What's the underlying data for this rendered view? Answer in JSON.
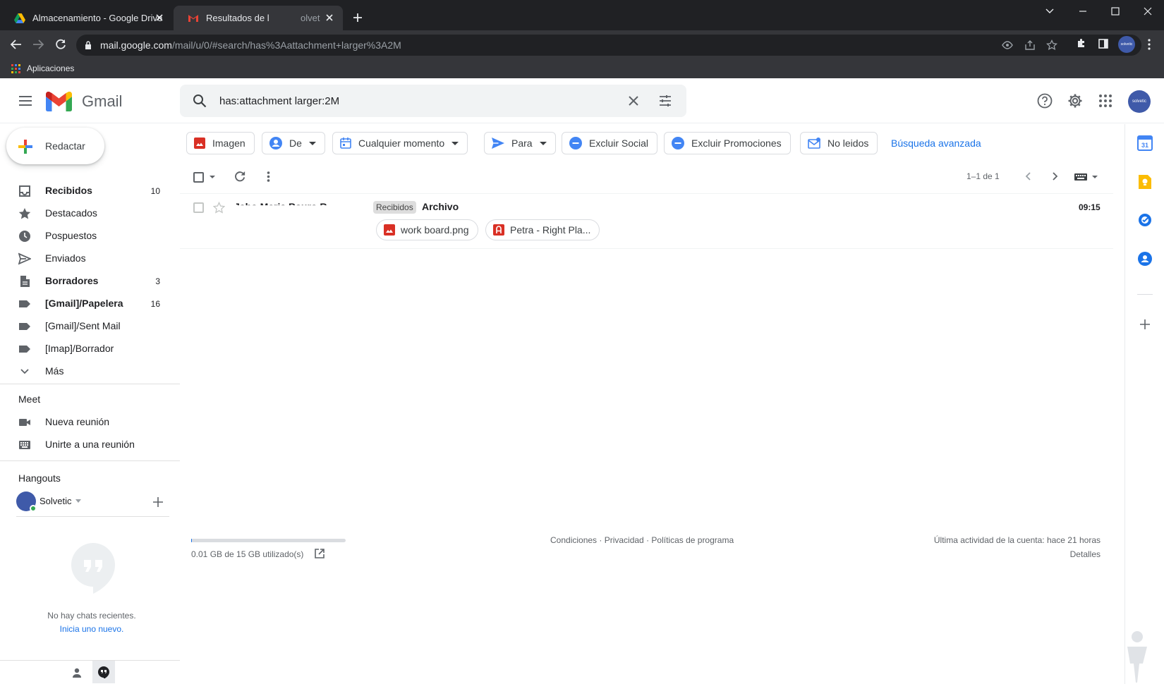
{
  "browser": {
    "tabs": [
      {
        "title": "Almacenamiento - Google Drive",
        "active": false
      },
      {
        "title": "Resultados de l",
        "title_tail": "olvet",
        "active": true
      }
    ],
    "url_host": "mail.google.com",
    "url_path": "/mail/u/0/#search/has%3Aattachment+larger%3A2M",
    "bookmarks_label": "Aplicaciones",
    "profile_initials": "solvetic"
  },
  "gmail": {
    "brand": "Gmail",
    "search_query": "has:attachment larger:2M",
    "avatar_text": "solvetic",
    "compose_label": "Redactar",
    "nav": [
      {
        "label": "Recibidos",
        "count": "10",
        "bold": true,
        "icon": "inbox-icon"
      },
      {
        "label": "Destacados",
        "count": "",
        "bold": false,
        "icon": "star-icon"
      },
      {
        "label": "Pospuestos",
        "count": "",
        "bold": false,
        "icon": "clock-icon"
      },
      {
        "label": "Enviados",
        "count": "",
        "bold": false,
        "icon": "send-icon"
      },
      {
        "label": "Borradores",
        "count": "3",
        "bold": true,
        "icon": "draft-icon"
      },
      {
        "label": "[Gmail]/Papelera",
        "count": "16",
        "bold": true,
        "icon": "label-icon"
      },
      {
        "label": "[Gmail]/Sent Mail",
        "count": "",
        "bold": false,
        "icon": "label-icon"
      },
      {
        "label": "[Imap]/Borrador",
        "count": "",
        "bold": false,
        "icon": "label-icon"
      },
      {
        "label": "Más",
        "count": "",
        "bold": false,
        "icon": "chevron-down-icon"
      }
    ],
    "meet": {
      "heading": "Meet",
      "new_meeting": "Nueva reunión",
      "join_meeting": "Unirte a una reunión"
    },
    "hangouts": {
      "heading": "Hangouts",
      "user": "Solvetic",
      "empty_text": "No hay chats recientes.",
      "start_link": "Inicia uno nuevo."
    },
    "filters": {
      "image": "Imagen",
      "from": "De",
      "any_time": "Cualquier momento",
      "to": "Para",
      "exclude_social": "Excluir Social",
      "exclude_promos": "Excluir Promociones",
      "unread": "No leidos",
      "advanced": "Búsqueda avanzada"
    },
    "pagination": "1–1 de 1",
    "email": {
      "sender": "Jaho Meria Bauro R",
      "tag": "Recibidos",
      "subject": "Archivo",
      "time": "09:15",
      "attachments": [
        {
          "name": "work board.png",
          "icon": "image-file-icon"
        },
        {
          "name": "Petra - Right Pla...",
          "icon": "pdf-file-icon"
        }
      ]
    },
    "footer": {
      "storage": "0.01 GB de 15 GB utilizado(s)",
      "storage_fraction": 0.0007,
      "links": "Condiciones · Privacidad · Políticas de programa",
      "last_activity": "Última actividad de la cuenta: hace 21 horas",
      "details": "Detalles"
    }
  }
}
